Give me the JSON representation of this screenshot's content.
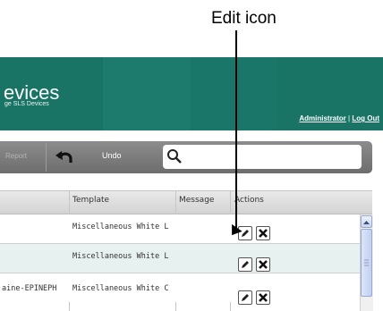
{
  "callout": {
    "label": "Edit icon"
  },
  "header": {
    "title": "evices",
    "subtitle": "ge SLS Devices",
    "user": "Administrator",
    "separator": "|",
    "logout": "Log Out"
  },
  "toolbar": {
    "report_label": "Report",
    "undo_label": "Undo",
    "search_value": ""
  },
  "table": {
    "columns": [
      "Template",
      "Message",
      "Actions"
    ],
    "rows": [
      {
        "name": "",
        "template": "Miscellaneous White L",
        "message": ""
      },
      {
        "name": "",
        "template": "Miscellaneous White L",
        "message": ""
      },
      {
        "name": "aine-EPINEPH",
        "template": "Miscellaneous White C",
        "message": ""
      }
    ]
  },
  "colors": {
    "header_bg": "#1a7466",
    "toolbar_bg": "#7c7c7c",
    "row_alt_bg": "#e7f1ef"
  },
  "icons": [
    "undo-icon",
    "search-icon",
    "edit-icon",
    "delete-icon",
    "scroll-up-icon"
  ]
}
